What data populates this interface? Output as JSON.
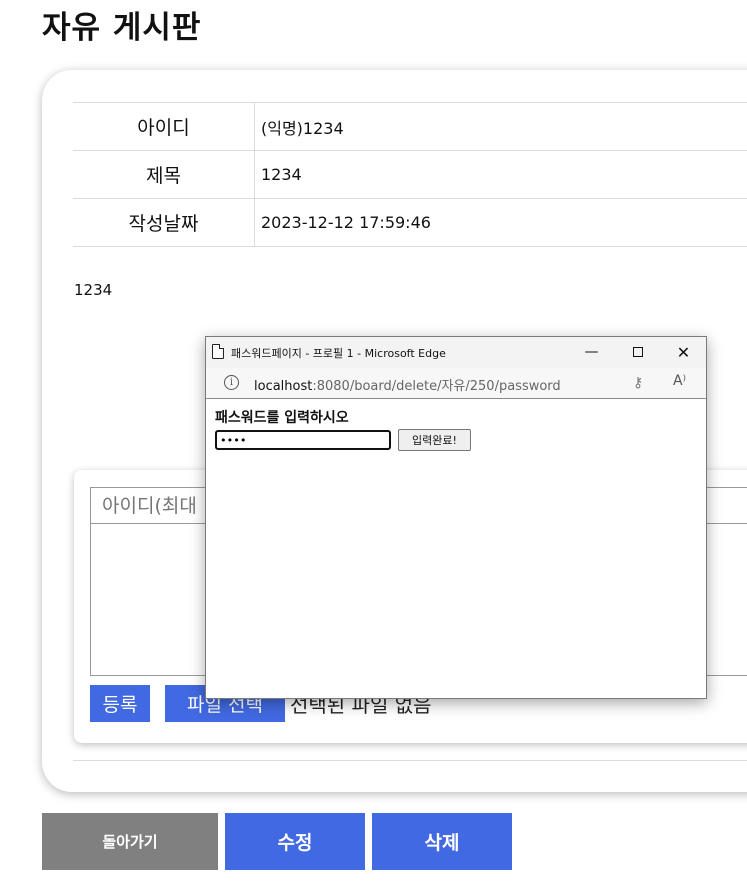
{
  "board": {
    "title": "자유 게시판"
  },
  "post": {
    "fields": [
      {
        "label": "아이디",
        "value": "(익명)1234"
      },
      {
        "label": "제목",
        "value": "1234"
      },
      {
        "label": "작성날짜",
        "value": "2023-12-12 17:59:46"
      }
    ],
    "content": "1234"
  },
  "comment_form": {
    "id_placeholder": "아이디(최대",
    "register_label": "등록",
    "file_button_label": "파일 선택",
    "file_status": "선택된 파일 없음"
  },
  "actions": {
    "back_label": "돌아가기",
    "edit_label": "수정",
    "delete_label": "삭제"
  },
  "popup": {
    "window_title": "패스워드페이지 - 프로필 1 - Microsoft Edge",
    "url_host": "localhost",
    "url_rest": ":8080/board/delete/자유/250/password",
    "prompt": "패스워드를 입력하시오",
    "password_value": "1234",
    "submit_label": "입력완료!",
    "minimize_glyph": "—",
    "close_glyph": "✕",
    "info_glyph": "i",
    "key_glyph": "⚷",
    "read_aloud_glyph": "A⁾"
  },
  "colors": {
    "accent": "#4169e1",
    "back_button": "#808080"
  }
}
